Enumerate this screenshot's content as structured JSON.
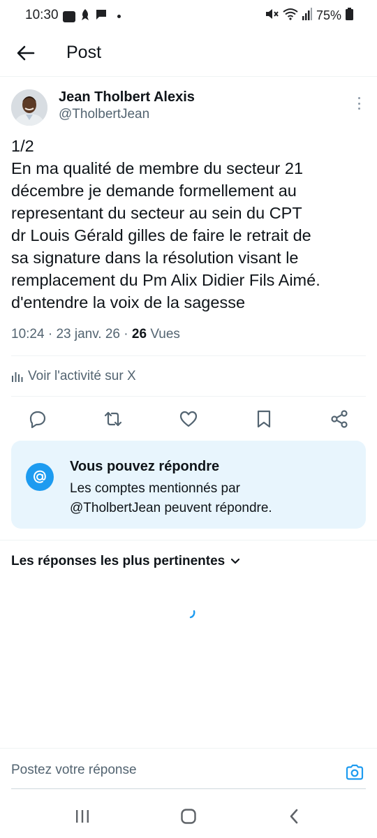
{
  "status_bar": {
    "time": "10:30",
    "battery": "75%",
    "icons_left": [
      "youtube-icon",
      "app-icon",
      "message-icon",
      "dot-icon"
    ],
    "icons_right": [
      "mute-icon",
      "wifi-icon",
      "signal-icon",
      "battery-icon"
    ]
  },
  "header": {
    "title": "Post"
  },
  "author": {
    "name": "Jean Tholbert Alexis",
    "handle": "@TholbertJean"
  },
  "tweet": {
    "text": "1/2\nEn ma qualité de membre du secteur 21\ndécembre je demande formellement au\nrepresentant du secteur au sein du CPT\ndr Louis Gérald gilles de faire le retrait de\nsa signature dans la résolution visant le\nremplacement du Pm Alix Didier Fils Aimé.\nd'entendre la voix de la sagesse",
    "time": "10:24",
    "date": "23 janv. 26",
    "separator": "·",
    "views_count": "26",
    "views_label": "Vues"
  },
  "activity_link": "Voir l'activité sur X",
  "actions": [
    "reply-icon",
    "retweet-icon",
    "like-icon",
    "bookmark-icon",
    "share-icon"
  ],
  "notice": {
    "title": "Vous pouvez répondre",
    "body": "Les comptes mentionnés par\n@TholbertJean peuvent répondre."
  },
  "replies_sort": "Les réponses les plus pertinentes",
  "compose": {
    "placeholder": "Postez votre réponse"
  },
  "colors": {
    "accent": "#1d9bf0",
    "notice_bg": "#e8f5fd",
    "text_primary": "#0f1419",
    "text_secondary": "#536471"
  }
}
